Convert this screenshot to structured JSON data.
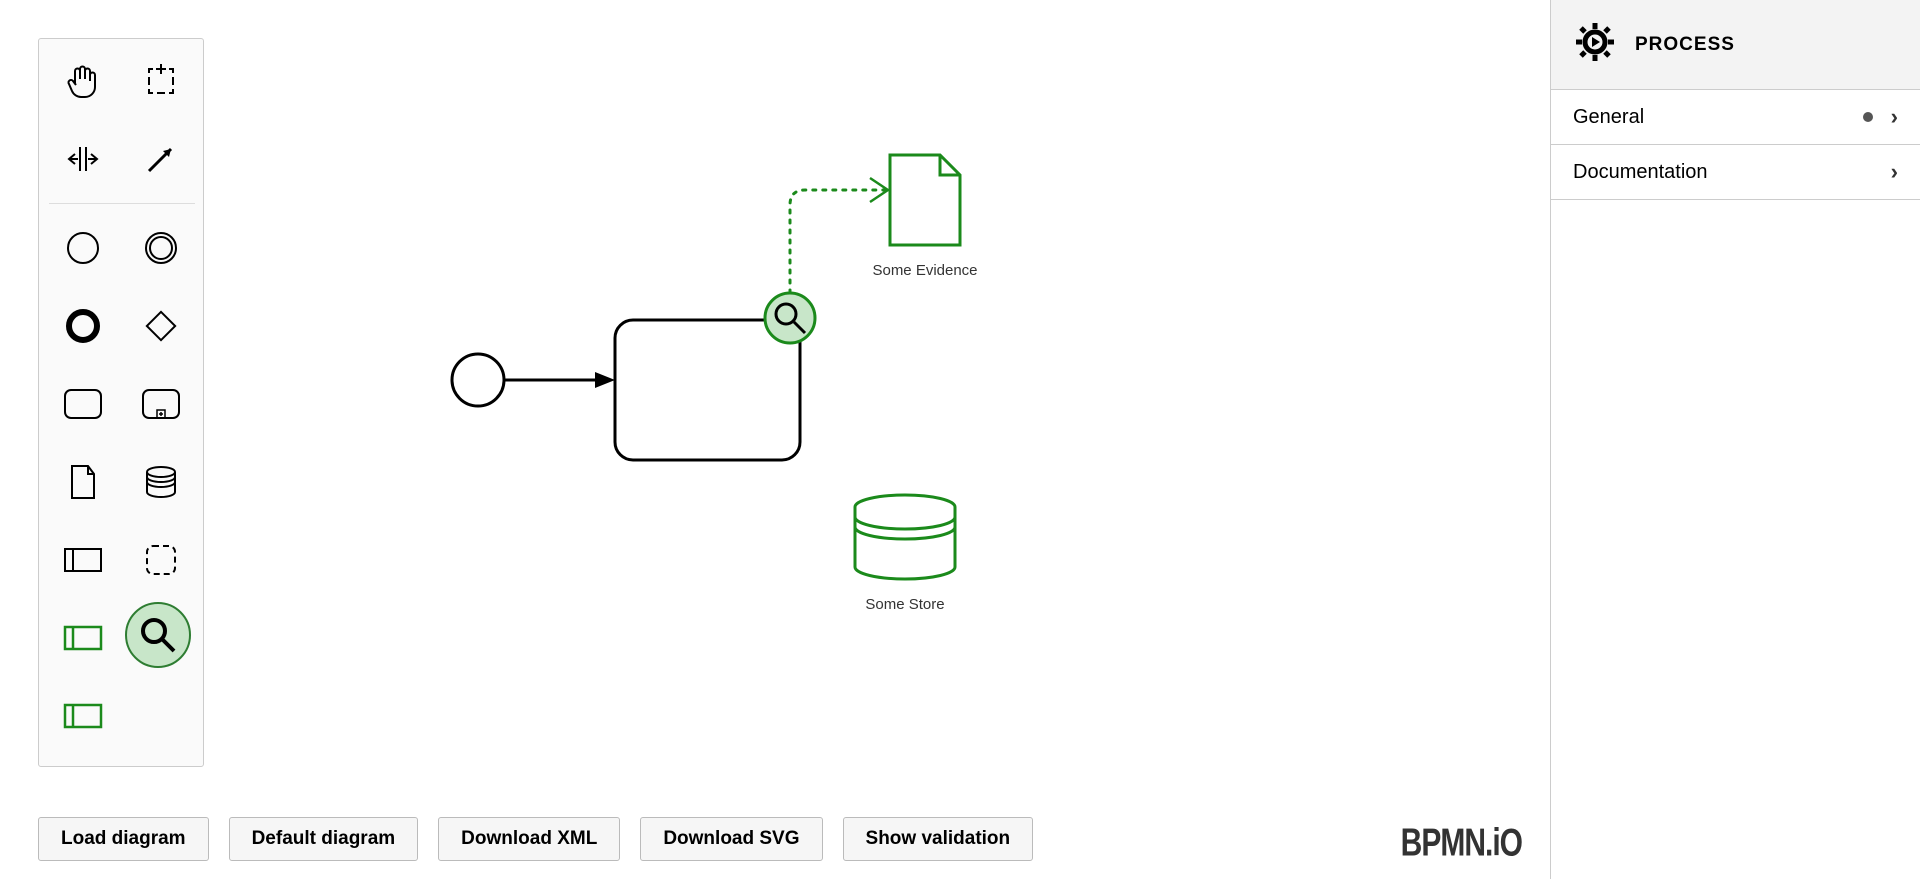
{
  "properties": {
    "title": "PROCESS",
    "rows": [
      {
        "label": "General",
        "has_dot": true
      },
      {
        "label": "Documentation",
        "has_dot": false
      }
    ]
  },
  "footer_buttons": [
    "Load diagram",
    "Default diagram",
    "Download XML",
    "Download SVG",
    "Show validation"
  ],
  "logo_text": "BPMN.iO",
  "diagram": {
    "evidence_label": "Some Evidence",
    "store_label": "Some Store"
  },
  "palette_tools": [
    "hand-tool",
    "lasso-tool",
    "space-tool",
    "global-connect-tool",
    "start-event",
    "end-event",
    "intermediate-event",
    "gateway",
    "task",
    "subprocess",
    "data-object",
    "data-store",
    "participant",
    "group",
    "green-lane-1",
    "magnify",
    "green-lane-2"
  ],
  "colors": {
    "green": "#1b8a1b",
    "light_green": "#c8e6c9"
  }
}
